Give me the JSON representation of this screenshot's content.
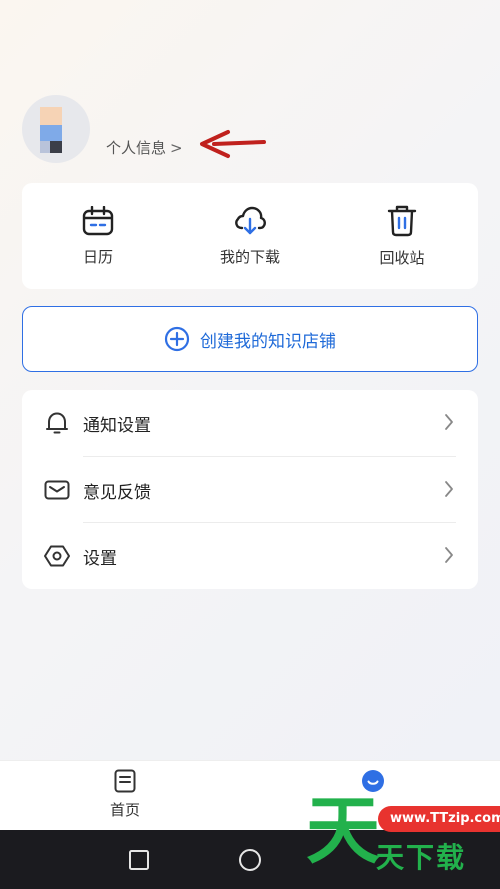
{
  "profile": {
    "link_label": "个人信息",
    "chevron": ">"
  },
  "quick_actions": [
    {
      "label": "日历",
      "icon": "calendar-icon"
    },
    {
      "label": "我的下载",
      "icon": "cloud-download-icon"
    },
    {
      "label": "回收站",
      "icon": "trash-icon"
    }
  ],
  "create_store": {
    "label": "创建我的知识店铺",
    "icon": "plus-circle-icon",
    "accent": "#2f6fe4"
  },
  "menu": [
    {
      "label": "通知设置",
      "icon": "bell-icon"
    },
    {
      "label": "意见反馈",
      "icon": "mail-icon"
    },
    {
      "label": "设置",
      "icon": "hexagon-settings-icon"
    }
  ],
  "tabs": [
    {
      "label": "首页",
      "icon": "document-icon"
    },
    {
      "label": "",
      "icon": "smile-icon",
      "active": true
    }
  ],
  "watermark": {
    "big_char": "天",
    "pill": "www.TTzip.com",
    "text": "天下载"
  },
  "colors": {
    "accent_blue": "#2f6fe4",
    "arrow_red": "#c0211d",
    "watermark_green": "#22b14c"
  }
}
